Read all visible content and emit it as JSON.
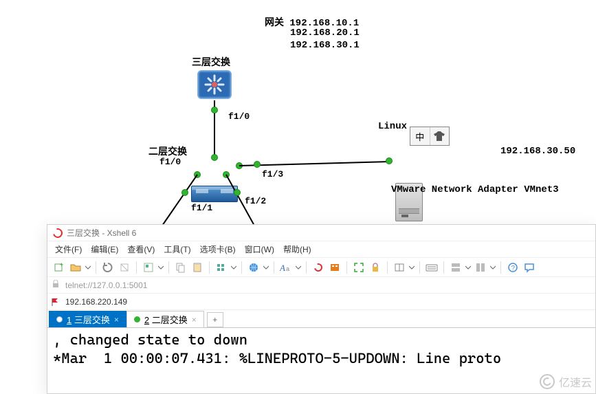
{
  "diagram": {
    "gateway_label": "网关",
    "gateways": [
      "192.168.10.1",
      "192.168.20.1",
      "192.168.30.1"
    ],
    "l3_label": "三层交换",
    "l2_label": "二层交换",
    "server_label_prefix": "Linux",
    "server_adapter": "VMware Network Adapter VMnet3",
    "server_ip": "192.168.30.50",
    "ports": {
      "l3_to_l2": "f1/0",
      "l2_up": "f1/0",
      "l2_down_left": "f1/1",
      "l2_down_right": "f1/2",
      "l2_right": "f1/3"
    },
    "ime": {
      "left": "中",
      "shirt_icon": "tshirt"
    }
  },
  "xshell": {
    "title": "三层交换 - Xshell 6",
    "menus": [
      "文件(F)",
      "编辑(E)",
      "查看(V)",
      "工具(T)",
      "选项卡(B)",
      "窗口(W)",
      "帮助(H)"
    ],
    "address": "telnet://127.0.0.1:5001",
    "session_ip": "192.168.220.149",
    "tabs": [
      {
        "index": "1",
        "label": "三层交换",
        "active": true,
        "dot": "#ffffff"
      },
      {
        "index": "2",
        "label": "二层交换",
        "active": false,
        "dot": "#33b233"
      }
    ],
    "terminal_lines": [
      ", changed state to down",
      "*Mar  1 00:00:07.431: %LINEPROTO-5-UPDOWN: Line proto"
    ]
  },
  "watermark": "亿速云"
}
